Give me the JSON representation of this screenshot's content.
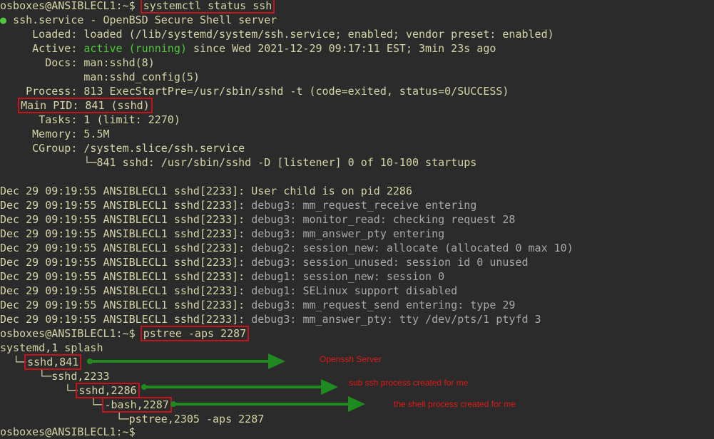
{
  "terminal": {
    "prompt": "osboxes@ANSIBLECL1:~$",
    "commands": {
      "status": "systemctl status ssh",
      "pstree": "pstree -aps 2287"
    },
    "status": {
      "bullet": "●",
      "service_line": "ssh.service - OpenBSD Secure Shell server",
      "loaded_label": "Loaded:",
      "loaded_value": "loaded (/lib/systemd/system/ssh.service; enabled; vendor preset: enabled)",
      "active_label": "Active:",
      "active_state": "active (running)",
      "active_rest": "since Wed 2021-12-29 09:17:11 EST; 3min 23s ago",
      "docs_label": "Docs:",
      "docs_1": "man:sshd(8)",
      "docs_2": "man:sshd_config(5)",
      "process_label": "Process:",
      "process_value": "813 ExecStartPre=/usr/sbin/sshd -t (code=exited, status=0/SUCCESS)",
      "mainpid": "Main PID: 841 (sshd)",
      "tasks_label": "Tasks:",
      "tasks_value": "1 (limit: 2270)",
      "memory_label": "Memory:",
      "memory_value": "5.5M",
      "cgroup_label": "CGroup:",
      "cgroup_value": "/system.slice/ssh.service",
      "cgroup_child": "└─841 sshd: /usr/sbin/sshd -D [listener] 0 of 10-100 startups"
    },
    "log_prefix": "Dec 29 09:19:55 ANSIBLECL1 sshd[2233]:",
    "logs": [
      "User child is on pid 2286",
      "debug3: mm_request_receive entering",
      "debug3: monitor_read: checking request 28",
      "debug3: mm_answer_pty entering",
      "debug2: session_new: allocate (allocated 0 max 10)",
      "debug3: session_unused: session id 0 unused",
      "debug1: session_new: session 0",
      "debug1: SELinux support disabled",
      "debug3: mm_request_send entering: type 29",
      "debug3: mm_answer_pty: tty /dev/pts/1 ptyfd 3"
    ],
    "tree": {
      "root": "systemd,1 splash",
      "branch": "└─",
      "sshd_main": "sshd,841",
      "sshd_child": "sshd,2233",
      "sshd_session": "sshd,2286",
      "bash": "-bash,2287",
      "pstree": "pstree,2305 -aps 2287"
    }
  },
  "annotations": {
    "openssh_server": "Openssh Server",
    "sub_ssh": "sub ssh process created for me",
    "shell_process": "the shell process created for me"
  },
  "colors": {
    "background": "#2b2b2b",
    "text": "#d4d4a6",
    "active_green": "#4ec93b",
    "debug_gray": "#a8a8a8",
    "highlight_red": "#c2161c",
    "arrow_green": "#1f8a1f",
    "annotation_red": "#e01818"
  }
}
